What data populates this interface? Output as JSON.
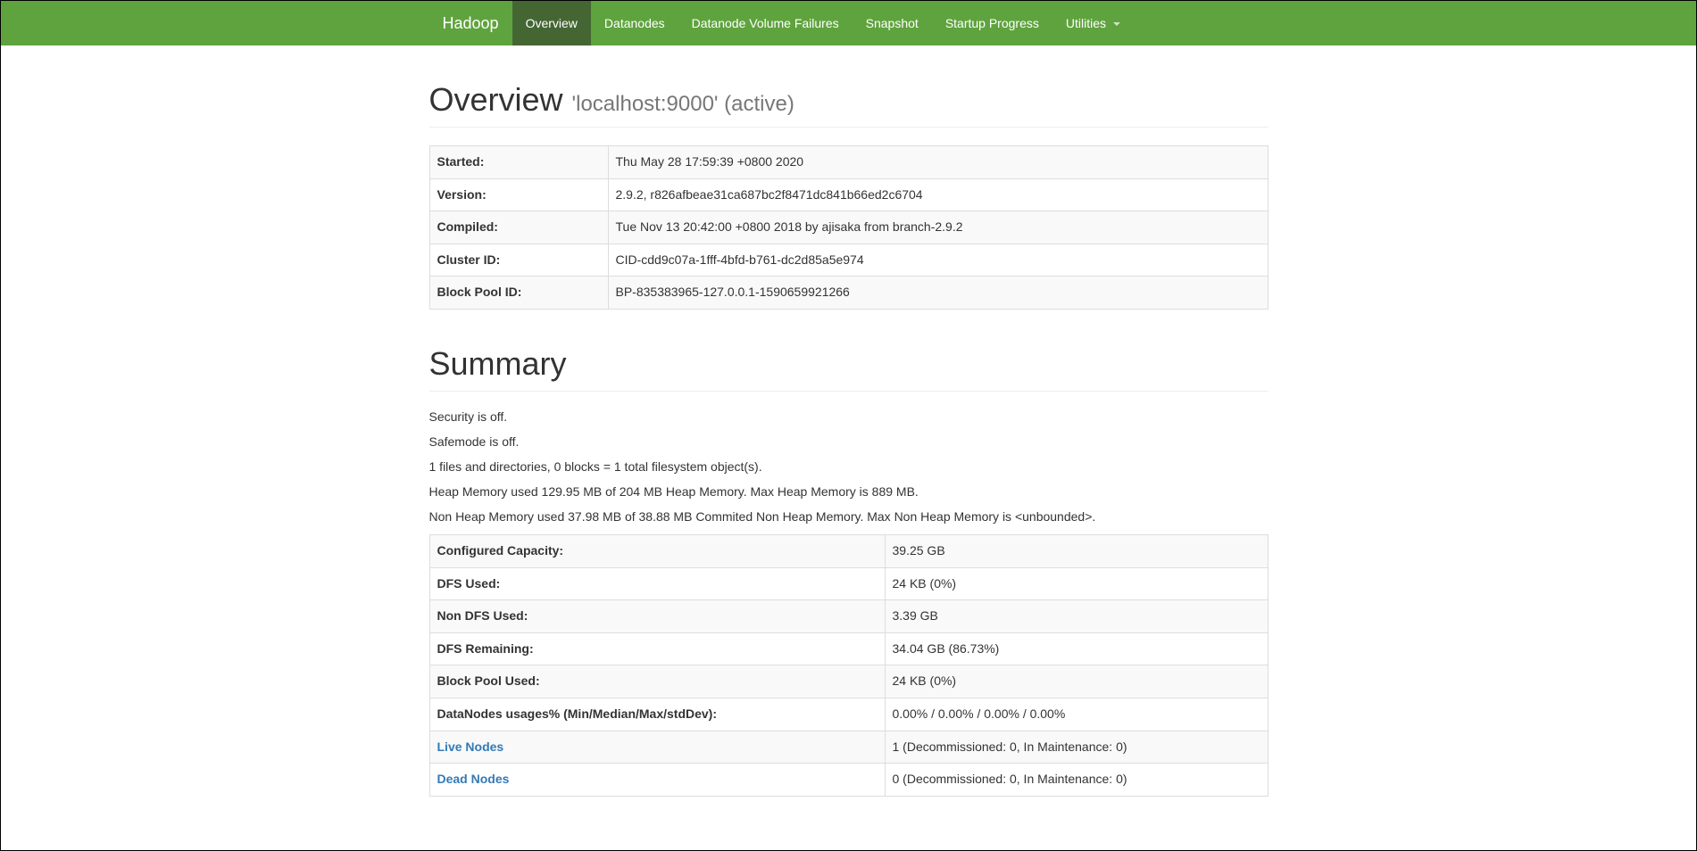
{
  "navbar": {
    "brand": "Hadoop",
    "items": [
      {
        "label": "Overview",
        "active": true
      },
      {
        "label": "Datanodes",
        "active": false
      },
      {
        "label": "Datanode Volume Failures",
        "active": false
      },
      {
        "label": "Snapshot",
        "active": false
      },
      {
        "label": "Startup Progress",
        "active": false
      },
      {
        "label": "Utilities",
        "active": false,
        "dropdown": true
      }
    ]
  },
  "overview": {
    "title": "Overview",
    "host": "'localhost:9000' (active)",
    "rows": [
      {
        "k": "Started:",
        "v": "Thu May 28 17:59:39 +0800 2020"
      },
      {
        "k": "Version:",
        "v": "2.9.2, r826afbeae31ca687bc2f8471dc841b66ed2c6704"
      },
      {
        "k": "Compiled:",
        "v": "Tue Nov 13 20:42:00 +0800 2018 by ajisaka from branch-2.9.2"
      },
      {
        "k": "Cluster ID:",
        "v": "CID-cdd9c07a-1fff-4bfd-b761-dc2d85a5e974"
      },
      {
        "k": "Block Pool ID:",
        "v": "BP-835383965-127.0.0.1-1590659921266"
      }
    ]
  },
  "summary": {
    "title": "Summary",
    "lines": [
      "Security is off.",
      "Safemode is off.",
      "1 files and directories, 0 blocks = 1 total filesystem object(s).",
      "Heap Memory used 129.95 MB of 204 MB Heap Memory. Max Heap Memory is 889 MB.",
      "Non Heap Memory used 37.98 MB of 38.88 MB Commited Non Heap Memory. Max Non Heap Memory is <unbounded>."
    ],
    "rows": [
      {
        "k": "Configured Capacity:",
        "v": "39.25 GB",
        "link": false
      },
      {
        "k": "DFS Used:",
        "v": "24 KB (0%)",
        "link": false
      },
      {
        "k": "Non DFS Used:",
        "v": "3.39 GB",
        "link": false
      },
      {
        "k": "DFS Remaining:",
        "v": "34.04 GB (86.73%)",
        "link": false
      },
      {
        "k": "Block Pool Used:",
        "v": "24 KB (0%)",
        "link": false
      },
      {
        "k": "DataNodes usages% (Min/Median/Max/stdDev):",
        "v": "0.00% / 0.00% / 0.00% / 0.00%",
        "link": false
      },
      {
        "k": "Live Nodes",
        "v": "1 (Decommissioned: 0, In Maintenance: 0)",
        "link": true
      },
      {
        "k": "Dead Nodes",
        "v": "0 (Decommissioned: 0, In Maintenance: 0)",
        "link": true
      }
    ]
  }
}
